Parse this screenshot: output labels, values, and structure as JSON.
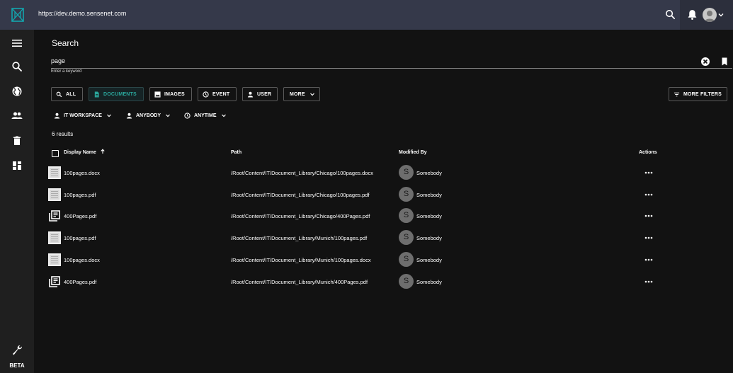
{
  "topbar": {
    "url": "https://dev.demo.sensenet.com",
    "icons": [
      "sensenet-logo-icon",
      "search-icon",
      "notifications-bell-icon",
      "user-avatar",
      "chevron-down-icon"
    ]
  },
  "sidebar": {
    "items": [
      "menu-icon",
      "search-icon",
      "globe-icon",
      "users-icon",
      "trash-icon",
      "dashboard-icon"
    ],
    "bottom_icon": "wrench-icon",
    "beta_label": "BETA"
  },
  "search": {
    "title": "Search",
    "query": "page",
    "helper": "Enter a keyword"
  },
  "type_chips": [
    {
      "label": "ALL",
      "icon": "search-icon",
      "active": false
    },
    {
      "label": "DOCUMENTS",
      "icon": "document-icon",
      "active": true
    },
    {
      "label": "IMAGES",
      "icon": "image-icon",
      "active": false
    },
    {
      "label": "EVENT",
      "icon": "clock-icon",
      "active": false
    },
    {
      "label": "USER",
      "icon": "person-icon",
      "active": false
    },
    {
      "label": "MORE",
      "icon": "chevron-down-icon",
      "active": false
    }
  ],
  "more_filters_label": "MORE FILTERS",
  "filters": [
    {
      "label": "IT WORKSPACE",
      "icon": "person-icon"
    },
    {
      "label": "ANYBODY",
      "icon": "person-icon"
    },
    {
      "label": "ANYTIME",
      "icon": "clock-icon"
    }
  ],
  "results_count": "6 results",
  "columns": {
    "display_name": "Display Name",
    "path": "Path",
    "modified_by": "Modified By",
    "actions": "Actions"
  },
  "rows": [
    {
      "name": "100pages.docx",
      "path": "/Root/Content/IT/Document_Library/Chicago/100pages.docx",
      "modified_by": "Somebody",
      "avatar_letter": "S",
      "icon": "document-thumbnail"
    },
    {
      "name": "100pages.pdf",
      "path": "/Root/Content/IT/Document_Library/Chicago/100pages.pdf",
      "modified_by": "Somebody",
      "avatar_letter": "S",
      "icon": "document-thumbnail"
    },
    {
      "name": "400Pages.pdf",
      "path": "/Root/Content/IT/Document_Library/Chicago/400Pages.pdf",
      "modified_by": "Somebody",
      "avatar_letter": "S",
      "icon": "library-icon"
    },
    {
      "name": "100pages.pdf",
      "path": "/Root/Content/IT/Document_Library/Munich/100pages.pdf",
      "modified_by": "Somebody",
      "avatar_letter": "S",
      "icon": "document-thumbnail"
    },
    {
      "name": "100pages.docx",
      "path": "/Root/Content/IT/Document_Library/Munich/100pages.docx",
      "modified_by": "Somebody",
      "avatar_letter": "S",
      "icon": "document-thumbnail"
    },
    {
      "name": "400Pages.pdf",
      "path": "/Root/Content/IT/Document_Library/Munich/400Pages.pdf",
      "modified_by": "Somebody",
      "avatar_letter": "S",
      "icon": "library-icon"
    }
  ],
  "colors": {
    "topbar": "#35394a",
    "sidebar": "#1f1f1f",
    "background": "#121212",
    "accent": "#2aa59b"
  }
}
